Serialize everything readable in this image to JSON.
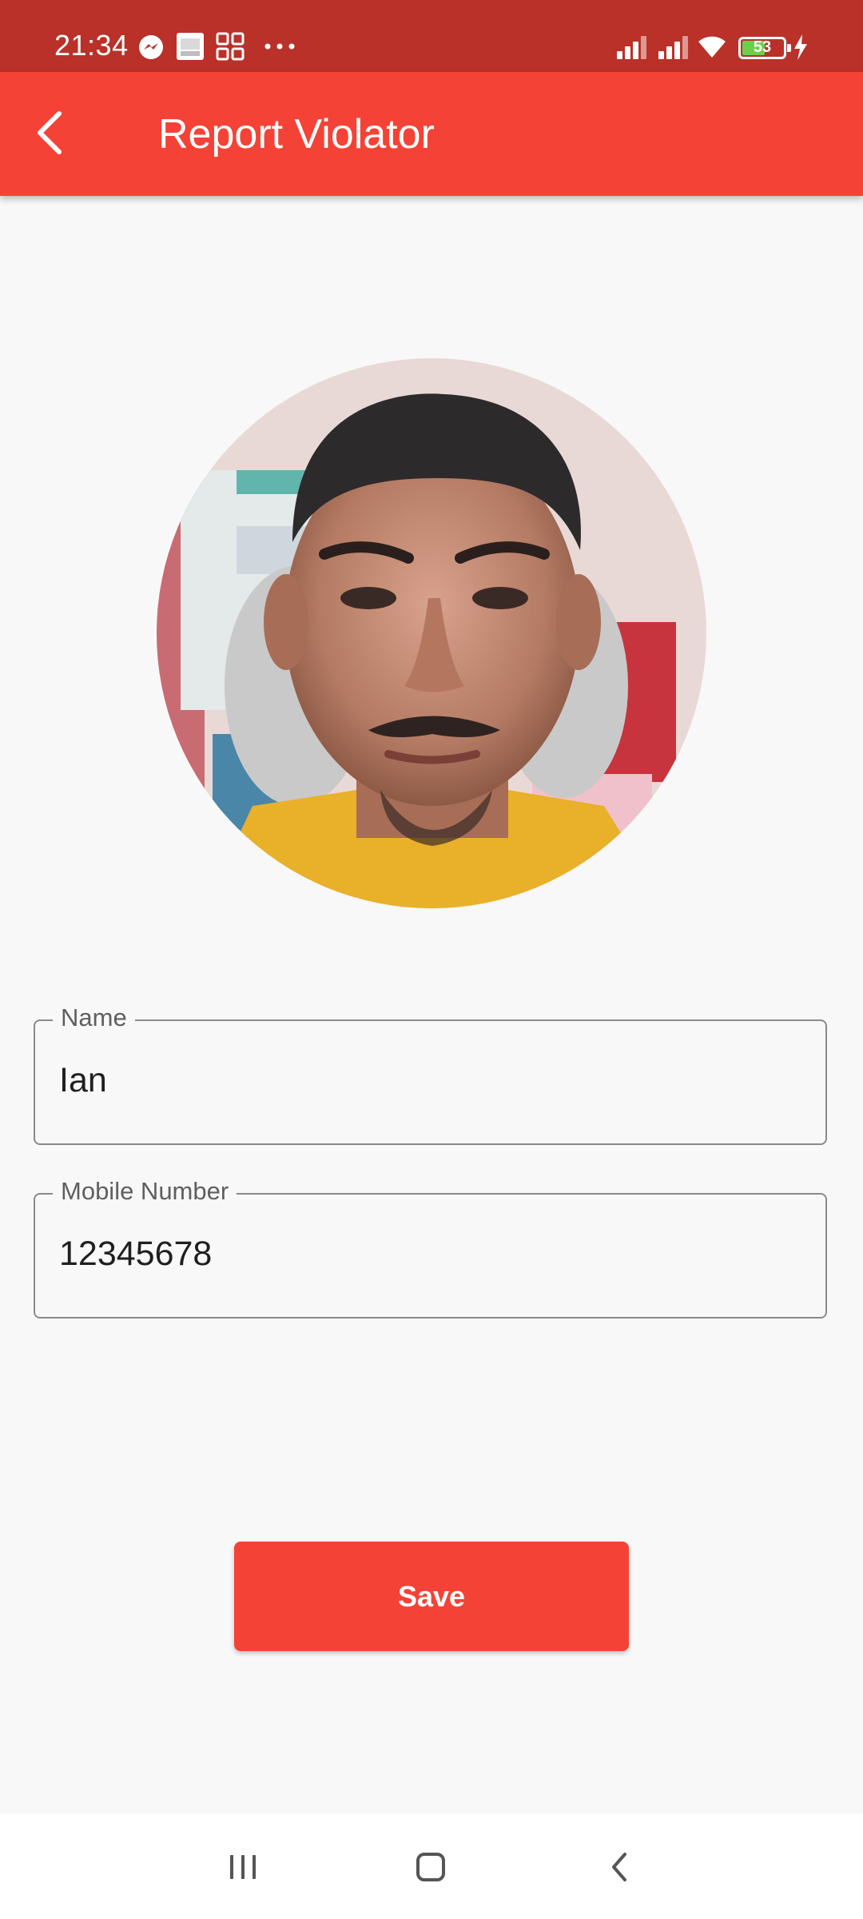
{
  "status_bar": {
    "time": "21:34",
    "battery_level": "53",
    "icons": [
      "messenger-icon",
      "gallery-icon",
      "apps-icon",
      "more-dots-icon",
      "signal-icon",
      "signal-icon",
      "wifi-icon",
      "battery-icon",
      "charging-icon"
    ]
  },
  "app_bar": {
    "title": "Report Violator",
    "back_icon": "arrow-back-icon",
    "background_color": "#f44336"
  },
  "photo": {
    "icon": "violator-photo"
  },
  "form": {
    "name_label": "Name",
    "name_value": "Ian",
    "mobile_label": "Mobile Number",
    "mobile_value": "12345678"
  },
  "actions": {
    "save_label": "Save",
    "accent_color": "#f44336"
  },
  "nav_bar": {
    "items": [
      "recent-apps-icon",
      "home-icon",
      "back-icon"
    ]
  }
}
